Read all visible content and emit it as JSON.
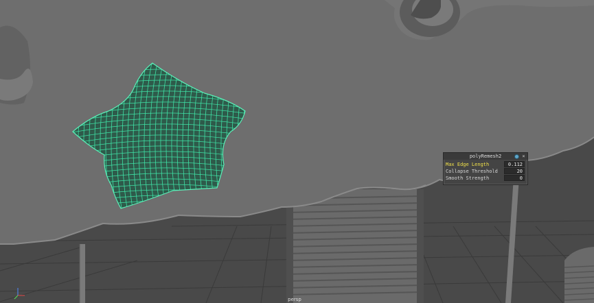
{
  "panel": {
    "title": "polyRemesh2",
    "attributes": [
      {
        "label": "Max Edge Length",
        "value": "0.112",
        "highlighted": true
      },
      {
        "label": "Collapse Threshold",
        "value": "20",
        "highlighted": false
      },
      {
        "label": "Smooth Strength",
        "value": "0",
        "highlighted": false
      }
    ]
  },
  "viewport": {
    "camera_label": "persp"
  },
  "colors": {
    "wireframe": "#3fe3a6",
    "background": "#4a4a4a",
    "surface": "#6d6d6d"
  },
  "icons": {
    "panel_settings": "settings-circle-icon",
    "panel_close": "close-icon",
    "axis_gizmo": "axis-gizmo-icon"
  }
}
